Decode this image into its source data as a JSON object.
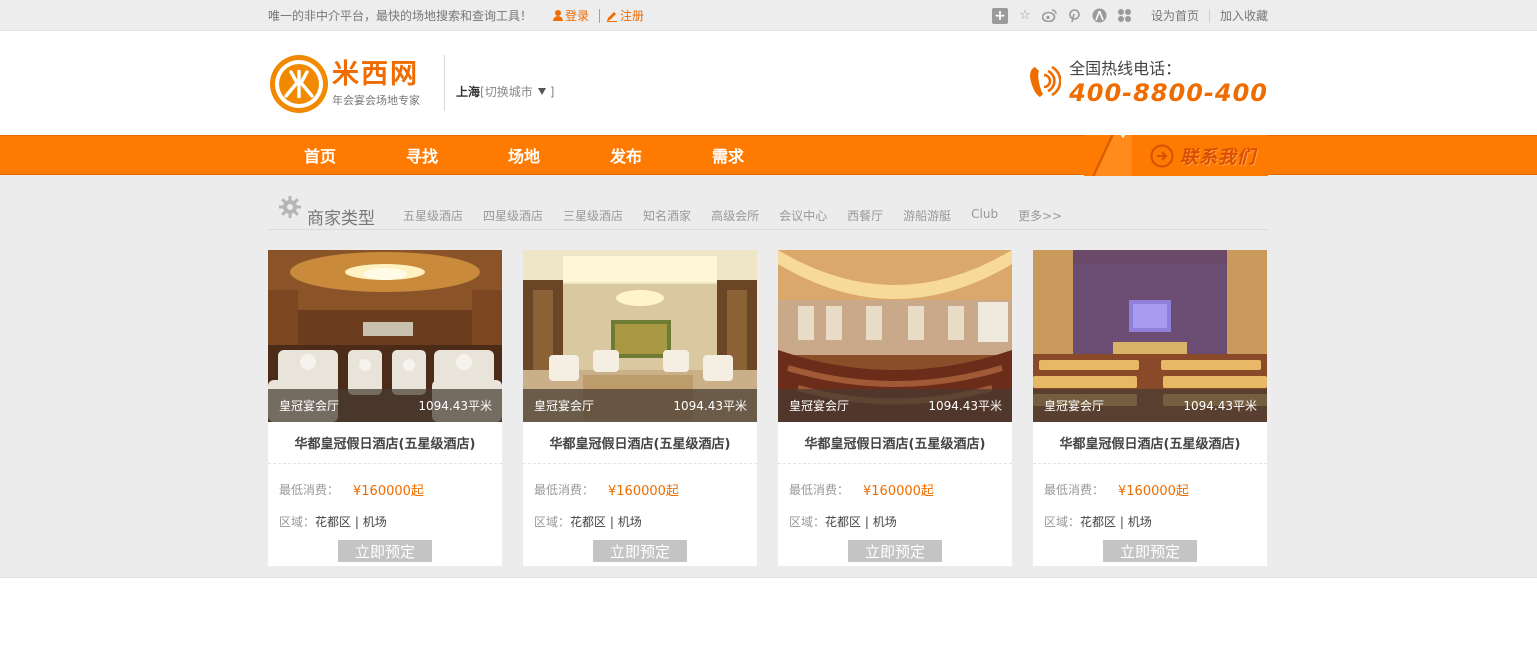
{
  "topbar": {
    "slogan": "唯一的非中介平台，最快的场地搜索和查询工具！",
    "login": "登录",
    "register": "注册",
    "set_home": "设为首页",
    "add_fav": "加入收藏",
    "share_icons": [
      "plus-icon",
      "star-icon",
      "weibo-icon",
      "pinterest-icon",
      "renren-icon",
      "kaixin-icon"
    ]
  },
  "header": {
    "logo_name": "米西网",
    "logo_sub": "年会宴会场地专家",
    "city_current": "上海",
    "city_switch": "[切换城市",
    "city_close": "]",
    "hotline_label": "全国热线电话：",
    "hotline_number": "400-8800-400"
  },
  "nav": {
    "items": [
      "首页",
      "寻找",
      "场地",
      "发布",
      "需求"
    ],
    "contact": "联系我们"
  },
  "category": {
    "title": "商家类型",
    "items": [
      "五星级酒店",
      "四星级酒店",
      "三星级酒店",
      "知名酒家",
      "高级会所",
      "会议中心",
      "西餐厅",
      "游船游艇",
      "Club",
      "更多>>"
    ]
  },
  "cards": [
    {
      "hall": "皇冠宴会厅",
      "area": "1094.43平米",
      "name": "华都皇冠假日酒店(五星级酒店)",
      "price_label": "最低消费：",
      "price": "¥160000起",
      "region_label": "区域：",
      "region": "花都区 | 机场",
      "book": "立即预定"
    },
    {
      "hall": "皇冠宴会厅",
      "area": "1094.43平米",
      "name": "华都皇冠假日酒店(五星级酒店)",
      "price_label": "最低消费：",
      "price": "¥160000起",
      "region_label": "区域：",
      "region": "花都区 | 机场",
      "book": "立即预定"
    },
    {
      "hall": "皇冠宴会厅",
      "area": "1094.43平米",
      "name": "华都皇冠假日酒店(五星级酒店)",
      "price_label": "最低消费：",
      "price": "¥160000起",
      "region_label": "区域：",
      "region": "花都区 | 机场",
      "book": "立即预定"
    },
    {
      "hall": "皇冠宴会厅",
      "area": "1094.43平米",
      "name": "华都皇冠假日酒店(五星级酒店)",
      "price_label": "最低消费：",
      "price": "¥160000起",
      "region_label": "区域：",
      "region": "花都区 | 机场",
      "book": "立即预定"
    }
  ],
  "colors": {
    "brand_orange": "#ff7a00",
    "price_orange": "#ef6c00",
    "content_bg": "#ececec"
  }
}
